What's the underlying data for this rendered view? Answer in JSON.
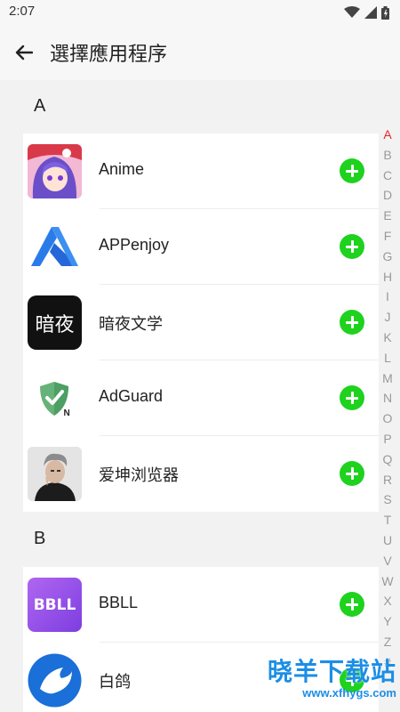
{
  "status_bar": {
    "time": "2:07"
  },
  "app_bar": {
    "title": "選擇應用程序"
  },
  "sections": [
    {
      "letter": "A",
      "apps": [
        {
          "name": "Anime",
          "icon": "anime-avatar-icon"
        },
        {
          "name": "APPenjoy",
          "icon": "appenjoy-logo-icon"
        },
        {
          "name": "暗夜文学",
          "icon": "anye-logo-icon",
          "icon_text": "暗夜"
        },
        {
          "name": "AdGuard",
          "icon": "adguard-shield-icon"
        },
        {
          "name": "爱坤浏览器",
          "icon": "aikun-avatar-icon"
        }
      ]
    },
    {
      "letter": "B",
      "apps": [
        {
          "name": "BBLL",
          "icon": "bbll-logo-icon",
          "icon_text": "BBLL"
        },
        {
          "name": "白鸽",
          "icon": "dove-logo-icon"
        }
      ]
    }
  ],
  "index_letters": [
    "A",
    "B",
    "C",
    "D",
    "E",
    "F",
    "G",
    "H",
    "I",
    "J",
    "K",
    "L",
    "M",
    "N",
    "O",
    "P",
    "Q",
    "R",
    "S",
    "T",
    "U",
    "V",
    "W",
    "X",
    "Y",
    "Z",
    "#"
  ],
  "active_index": "A",
  "watermark": {
    "title": "晓羊下载站",
    "url": "www.xfhygs.com"
  },
  "colors": {
    "add_button": "#1ed21e",
    "active_index": "#e2262b",
    "watermark": "#1b8ee6"
  }
}
